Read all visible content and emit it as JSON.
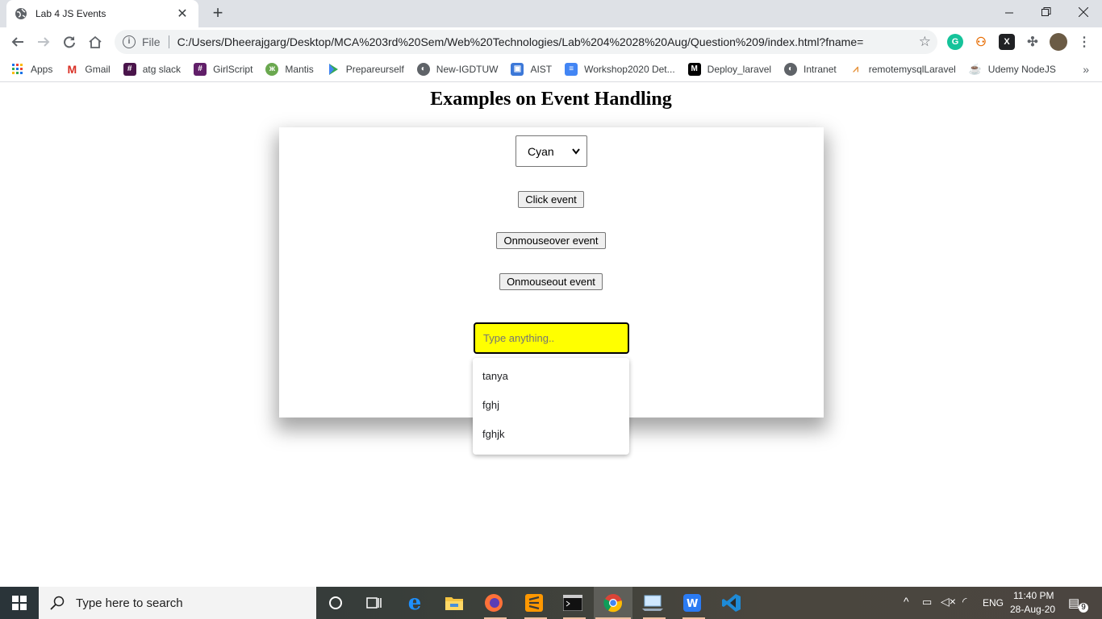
{
  "browser": {
    "tab_title": "Lab 4 JS Events",
    "new_tab_symbol": "+",
    "omnibox_label": "File",
    "url": "C:/Users/Dheerajgarg/Desktop/MCA%203rd%20Sem/Web%20Technologies/Lab%204%2028%20Aug/Question%209/index.html?fname="
  },
  "bookmarks": [
    {
      "label": "Apps",
      "icon": "apps-grid-icon",
      "color": "#ea4335"
    },
    {
      "label": "Gmail",
      "icon": "gmail-icon",
      "color": "#d93025"
    },
    {
      "label": "atg slack",
      "icon": "slack-icon",
      "color": "#4a154b"
    },
    {
      "label": "GirlScript",
      "icon": "slack-icon",
      "color": "#611f69"
    },
    {
      "label": "Mantis",
      "icon": "mantis-icon",
      "color": "#6aa84f"
    },
    {
      "label": "Prepareurself",
      "icon": "play-icon",
      "color": "#34a853"
    },
    {
      "label": "New-IGDTUW",
      "icon": "globe-icon",
      "color": "#5f6368"
    },
    {
      "label": "AIST",
      "icon": "aist-icon",
      "color": "#3c78d8"
    },
    {
      "label": "Workshop2020 Det...",
      "icon": "forms-icon",
      "color": "#4285f4"
    },
    {
      "label": "Deploy_laravel",
      "icon": "medium-icon",
      "color": "#000000"
    },
    {
      "label": "Intranet",
      "icon": "globe-icon",
      "color": "#5f6368"
    },
    {
      "label": "remotemysqlLaravel",
      "icon": "remotemysql-icon",
      "color": "#e69138"
    },
    {
      "label": "Udemy NodeJS",
      "icon": "udemy-icon",
      "color": "#a435f0"
    }
  ],
  "page": {
    "title": "Examples on Event Handling",
    "color_select_value": "Cyan",
    "buttons": {
      "click": "Click event",
      "mouseover": "Onmouseover event",
      "mouseout": "Onmouseout event"
    },
    "input_placeholder": "Type anything..",
    "autocomplete_items": [
      "tanya",
      "fghj",
      "fghjk"
    ]
  },
  "taskbar": {
    "search_placeholder": "Type here to search",
    "language": "ENG",
    "time": "11:40 PM",
    "date": "28-Aug-20",
    "notification_count": "9"
  },
  "colors": {
    "input_bg": "#ffff00",
    "tabstrip": "#dee1e6"
  }
}
